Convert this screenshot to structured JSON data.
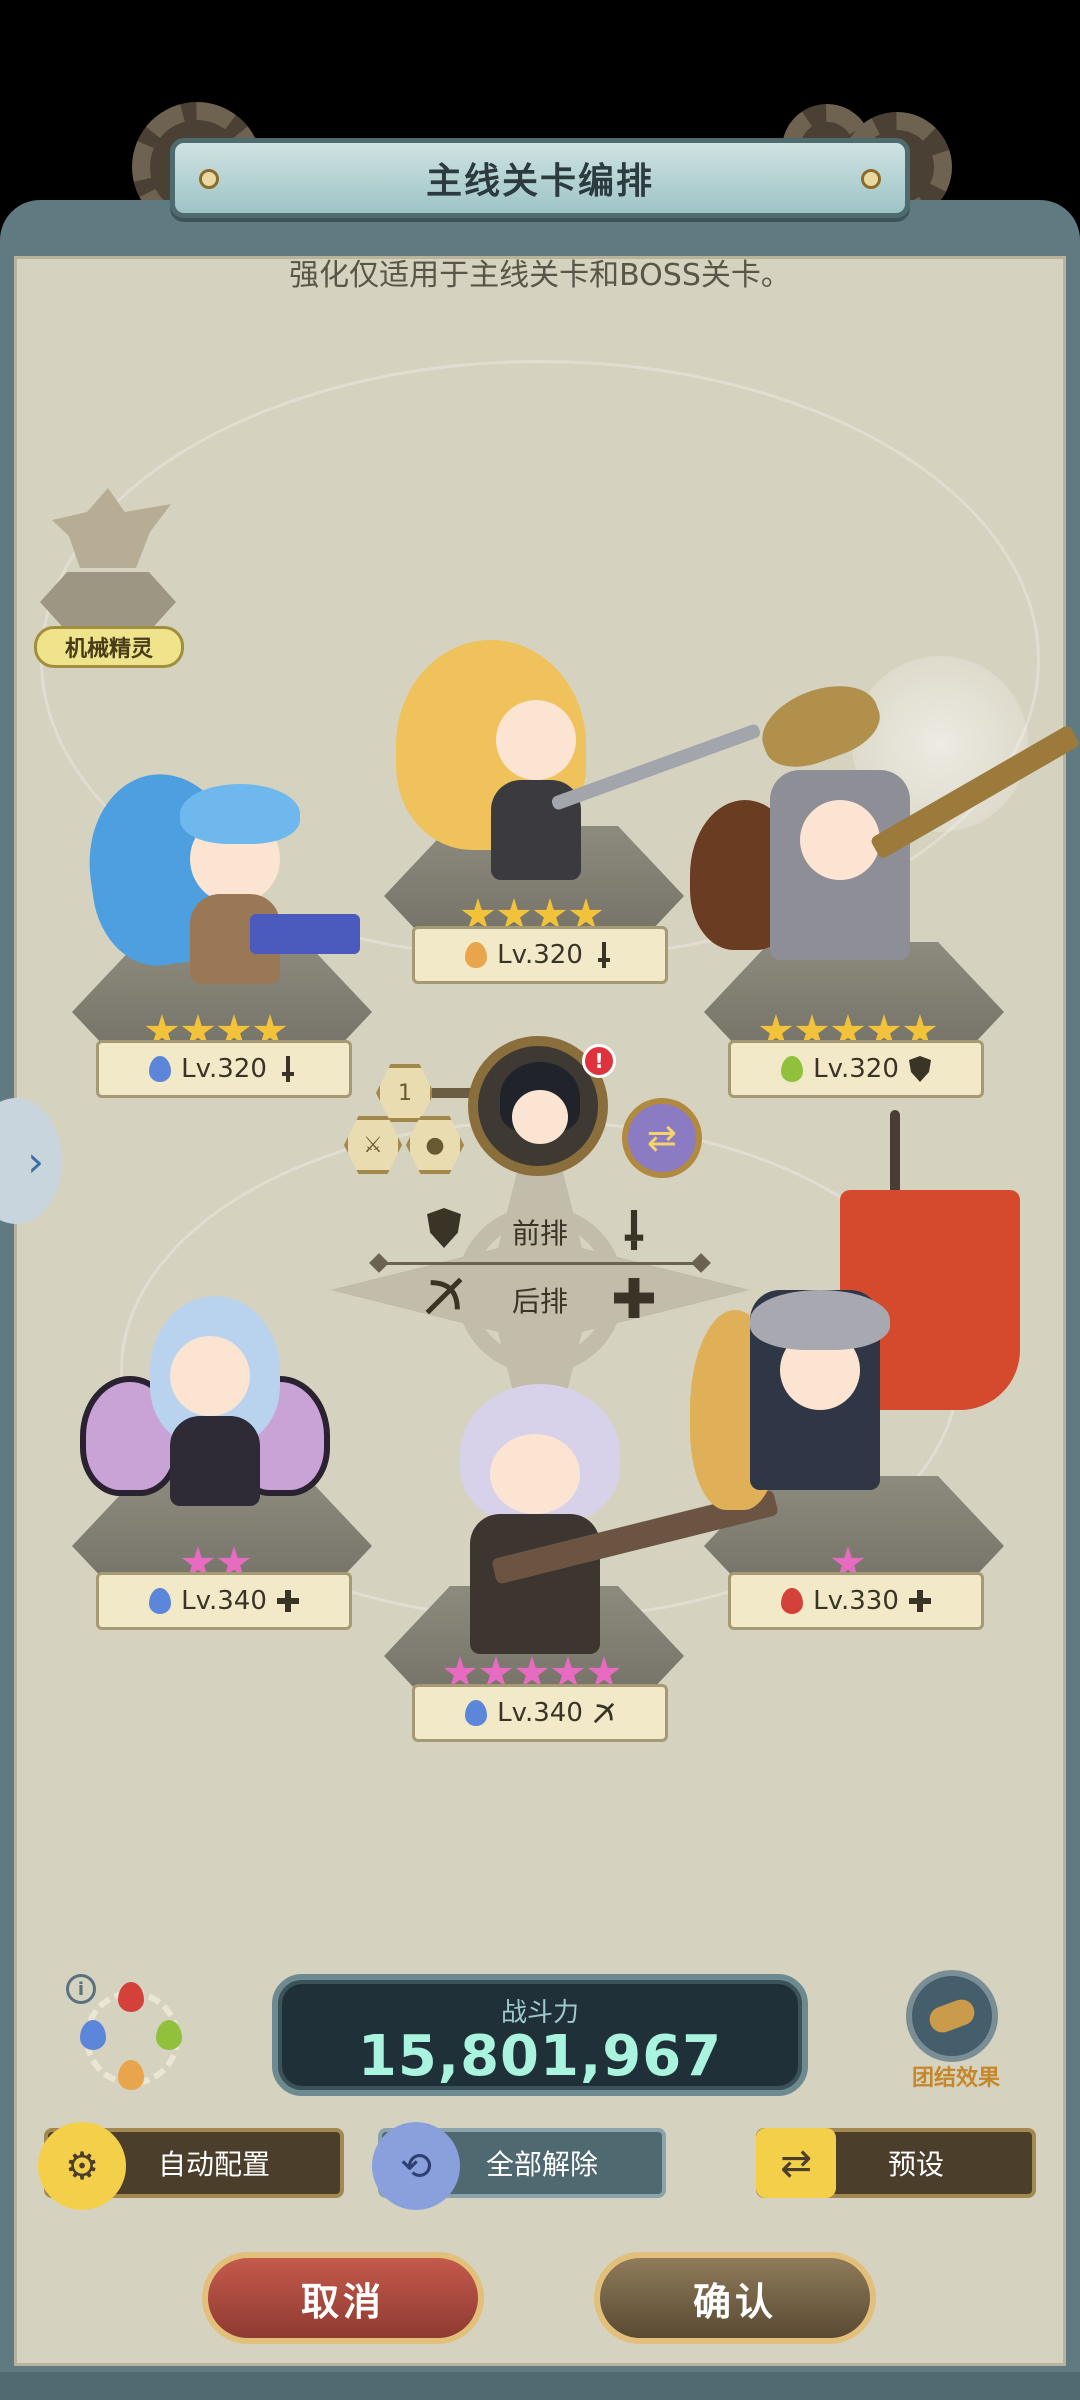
{
  "header": {
    "title": "主线关卡编排"
  },
  "subtitle": "强化仅适用于主线关卡和BOSS关卡。",
  "spirit": {
    "label": "机械精灵"
  },
  "heroes": [
    {
      "id": "back-left-top",
      "level": "Lv.320",
      "stars": 4,
      "star_color": "gold",
      "element": "water",
      "role": "sword"
    },
    {
      "id": "front-center",
      "level": "Lv.320",
      "stars": 4,
      "star_color": "gold",
      "element": "earth",
      "role": "sword"
    },
    {
      "id": "right-top",
      "level": "Lv.320",
      "stars": 5,
      "star_color": "gold",
      "element": "wind",
      "role": "shield"
    },
    {
      "id": "left-bottom",
      "level": "Lv.340",
      "stars": 2,
      "star_color": "pink",
      "element": "water",
      "role": "plus"
    },
    {
      "id": "center-bottom",
      "level": "Lv.340",
      "stars": 5,
      "star_color": "pink",
      "element": "water",
      "role": "bow"
    },
    {
      "id": "right-bottom",
      "level": "Lv.330",
      "stars": 1,
      "star_color": "pink",
      "element": "fire",
      "role": "plus"
    }
  ],
  "leader": {
    "number": "1",
    "alert": "!"
  },
  "rows": {
    "front": "前排",
    "back": "后排"
  },
  "power": {
    "label": "战斗力",
    "value": "15,801,967"
  },
  "unity": {
    "label": "团结效果"
  },
  "buttons": {
    "auto": "自动配置",
    "clear": "全部解除",
    "preset": "预设",
    "cancel": "取消",
    "confirm": "确认"
  },
  "colors": {
    "water": "#5b86d9",
    "fire": "#d3413a",
    "earth": "#e8a54b",
    "wind": "#8fc13d",
    "gold_star": "#f2c23a",
    "pink_star": "#e66bc1",
    "power_text": "#a9f3df"
  },
  "icons": {
    "sword": "sword-icon",
    "shield": "shield-icon",
    "bow": "bow-icon",
    "plus": "healer-plus-icon"
  }
}
